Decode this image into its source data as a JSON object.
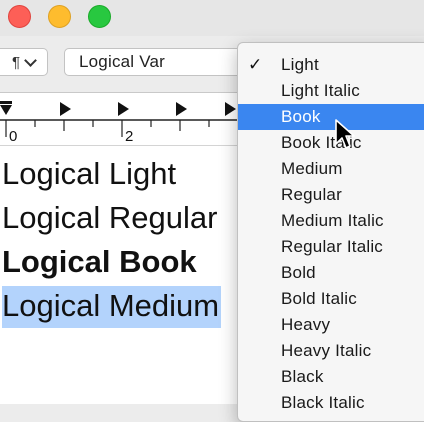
{
  "window": {
    "buttons": [
      "close",
      "minimize",
      "zoom"
    ]
  },
  "toolbar": {
    "paragraph_symbol": "¶",
    "font_family_value": "Logical Var"
  },
  "ruler": {
    "labels": [
      "0",
      "2"
    ]
  },
  "document": {
    "lines": [
      "Logical Light",
      "Logical Regular",
      "Logical Book",
      "Logical Medium"
    ],
    "selected_line_index": 3
  },
  "menu": {
    "checkmark": "✓",
    "checked_index": 0,
    "highlighted_index": 2,
    "highlight_color": "#3a86f0",
    "items": [
      "Light",
      "Light Italic",
      "Book",
      "Book Italic",
      "Medium",
      "Regular",
      "Medium Italic",
      "Regular Italic",
      "Bold",
      "Bold Italic",
      "Heavy",
      "Heavy Italic",
      "Black",
      "Black Italic"
    ]
  },
  "colors": {
    "close": "#fd5f57",
    "minimize": "#febc2e",
    "zoom": "#28c840",
    "text_selection": "#b3d3fc"
  },
  "icons": {
    "pointer": "arrow-pointer-icon"
  }
}
